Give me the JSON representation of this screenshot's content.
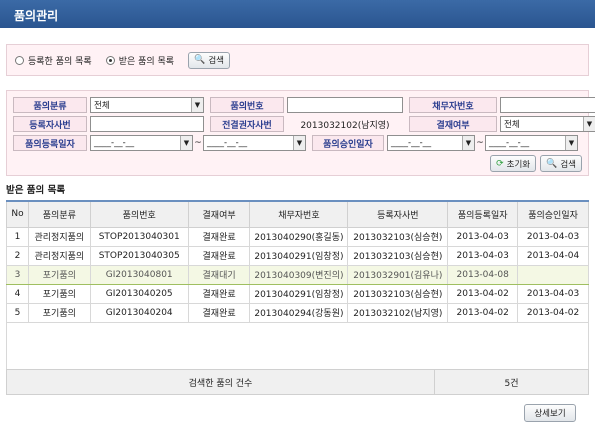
{
  "title": "품의관리",
  "mode": {
    "options": [
      {
        "label": "등록한 품의 목록",
        "checked": false
      },
      {
        "label": "받은 품의 목록",
        "checked": true
      }
    ],
    "search_label": "검색"
  },
  "filters": {
    "category_label": "품의분류",
    "category_value": "전체",
    "number_label": "품의번호",
    "number_value": "",
    "debtor_label": "채무자번호",
    "debtor_value": "",
    "registrant_label": "등록자사번",
    "registrant_value": "",
    "approver_label": "전결권자사번",
    "approver_value": "2013032102(남지영)",
    "approval_label": "결재여부",
    "approval_value": "전체",
    "regdate_label": "품의등록일자",
    "regdate_from": "____-__-__",
    "regdate_to": "____-__-__",
    "appdate_label": "품의승인일자",
    "appdate_from": "____-__-__",
    "appdate_to": "____-__-__",
    "tilde": "~",
    "reset_label": "초기화",
    "search_label": "검색"
  },
  "list": {
    "title": "받은 품의 목록",
    "columns": [
      "No",
      "품의분류",
      "품의번호",
      "결재여부",
      "채무자번호",
      "등록자사번",
      "품의등록일자",
      "품의승인일자"
    ],
    "rows": [
      [
        "1",
        "관리정지품의",
        "STOP2013040301",
        "결재완료",
        "2013040290(홍길동)",
        "2013032103(심승현)",
        "2013-04-03",
        "2013-04-03"
      ],
      [
        "2",
        "관리정지품의",
        "STOP2013040305",
        "결재완료",
        "2013040291(임창정)",
        "2013032103(심승현)",
        "2013-04-03",
        "2013-04-04"
      ],
      [
        "3",
        "포기품의",
        "GI2013040801",
        "결재대기",
        "2013040309(변진의)",
        "2013032901(김유나)",
        "2013-04-08",
        ""
      ],
      [
        "4",
        "포기품의",
        "GI2013040205",
        "결재완료",
        "2013040291(임창정)",
        "2013032103(심승현)",
        "2013-04-02",
        "2013-04-03"
      ],
      [
        "5",
        "포기품의",
        "GI2013040204",
        "결재완료",
        "2013040294(강동원)",
        "2013032102(남지영)",
        "2013-04-02",
        "2013-04-02"
      ]
    ],
    "selected_row": 2,
    "footer_label": "검색한 품의 건수",
    "footer_count": "5건"
  },
  "detail_label": "상세보기"
}
